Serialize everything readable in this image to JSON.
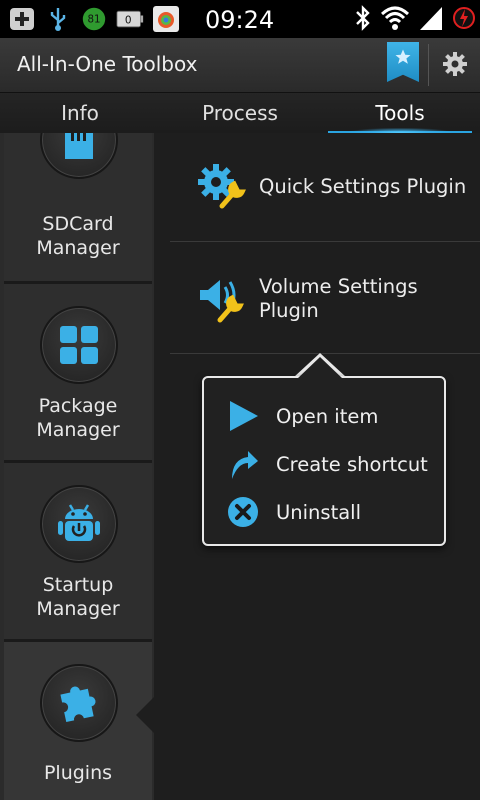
{
  "status_bar": {
    "time": "09:24",
    "battery_level_badge": "0",
    "temp_badge": "81",
    "colors": {
      "background": "#000000",
      "text": "#ffffff"
    },
    "icons": [
      "notification-plus-icon",
      "usb-icon",
      "temperature-badge-icon",
      "battery-widget-icon",
      "app-notification-icon",
      "bluetooth-icon",
      "wifi-icon",
      "signal-icon",
      "battery-charging-icon"
    ]
  },
  "app_bar": {
    "title": "All-In-One Toolbox",
    "icons": [
      "star-bookmark-icon",
      "gear-icon"
    ]
  },
  "tabs": {
    "items": [
      {
        "label": "Info",
        "active": false
      },
      {
        "label": "Process",
        "active": false
      },
      {
        "label": "Tools",
        "active": true
      }
    ],
    "accent": "#2aa4e0"
  },
  "sidebar": {
    "items": [
      {
        "label_line1": "SDCard",
        "label_line2": "Manager",
        "icon": "sdcard-icon",
        "selected": false
      },
      {
        "label_line1": "Package",
        "label_line2": "Manager",
        "icon": "package-grid-icon",
        "selected": false
      },
      {
        "label_line1": "Startup",
        "label_line2": "Manager",
        "icon": "android-power-icon",
        "selected": false
      },
      {
        "label_line1": "Plugins",
        "label_line2": "",
        "icon": "puzzle-piece-icon",
        "selected": true
      }
    ],
    "icon_color": "#3bb0e6"
  },
  "plugins": {
    "items": [
      {
        "label_line1": "Quick Settings Plugin",
        "label_line2": "",
        "icon": "gear-wrench-icon"
      },
      {
        "label_line1": "Volume Settings",
        "label_line2": "Plugin",
        "icon": "speaker-wrench-icon"
      }
    ]
  },
  "context_menu": {
    "items": [
      {
        "label": "Open item",
        "icon": "play-arrow-icon"
      },
      {
        "label": "Create shortcut",
        "icon": "curved-arrow-icon"
      },
      {
        "label": "Uninstall",
        "icon": "close-circle-icon"
      }
    ]
  }
}
